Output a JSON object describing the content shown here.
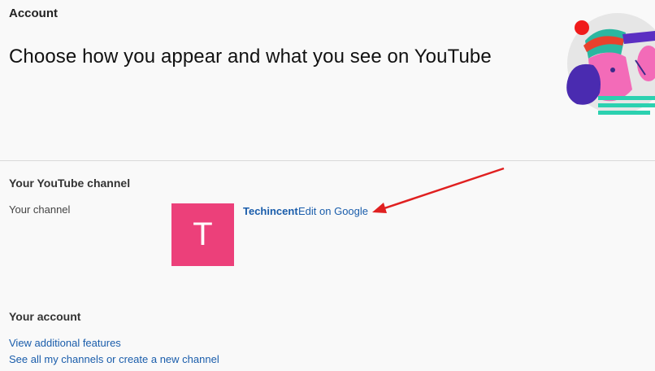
{
  "header": {
    "section_label": "Account",
    "headline": "Choose how you appear and what you see on YouTube"
  },
  "channel_section": {
    "heading": "Your YouTube channel",
    "row_label": "Your channel",
    "avatar_letter": "T",
    "avatar_color": "#ec407a",
    "channel_name": "Techincent",
    "edit_link": "Edit on Google"
  },
  "account_section": {
    "heading": "Your account",
    "links": [
      "View additional features",
      "See all my channels or create a new channel"
    ]
  },
  "colors": {
    "link": "#1a5dab",
    "annotation_arrow": "#e02020"
  }
}
